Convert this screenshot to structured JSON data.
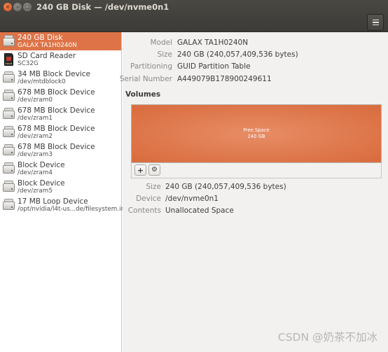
{
  "window": {
    "title": "240 GB Disk — /dev/nvme0n1",
    "close_glyph": "×",
    "minimize_glyph": "–",
    "maximize_glyph": "□",
    "menu_icon": "hamburger-menu-icon"
  },
  "sidebar": {
    "items": [
      {
        "name": "240 GB Disk",
        "sub": "GALAX TA1H0240N",
        "icon": "hard-disk-icon",
        "selected": true
      },
      {
        "name": "SD Card Reader",
        "sub": "SC32G",
        "icon": "sd-card-icon",
        "selected": false
      },
      {
        "name": "34 MB Block Device",
        "sub": "/dev/mtdblock0",
        "icon": "hard-disk-icon",
        "selected": false
      },
      {
        "name": "678 MB Block Device",
        "sub": "/dev/zram0",
        "icon": "hard-disk-icon",
        "selected": false
      },
      {
        "name": "678 MB Block Device",
        "sub": "/dev/zram1",
        "icon": "hard-disk-icon",
        "selected": false
      },
      {
        "name": "678 MB Block Device",
        "sub": "/dev/zram2",
        "icon": "hard-disk-icon",
        "selected": false
      },
      {
        "name": "678 MB Block Device",
        "sub": "/dev/zram3",
        "icon": "hard-disk-icon",
        "selected": false
      },
      {
        "name": "Block Device",
        "sub": "/dev/zram4",
        "icon": "hard-disk-icon",
        "selected": false
      },
      {
        "name": "Block Device",
        "sub": "/dev/zram5",
        "icon": "hard-disk-icon",
        "selected": false
      },
      {
        "name": "17 MB Loop Device",
        "sub": "/opt/nvidia/l4t-us...de/filesystem.img",
        "icon": "hard-disk-icon",
        "selected": false
      }
    ]
  },
  "disk_info": {
    "model_label": "Model",
    "model": "GALAX TA1H0240N",
    "size_label": "Size",
    "size": "240 GB (240,057,409,536 bytes)",
    "partitioning_label": "Partitioning",
    "partitioning": "GUID Partition Table",
    "serial_label": "Serial Number",
    "serial": "A449079B178900249611"
  },
  "volumes": {
    "heading": "Volumes",
    "block_name": "Free Space",
    "block_size": "240 GB",
    "add_glyph": "+",
    "settings_glyph": "⚙"
  },
  "volume_info": {
    "size_label": "Size",
    "size": "240 GB (240,057,409,536 bytes)",
    "device_label": "Device",
    "device": "/dev/nvme0n1",
    "contents_label": "Contents",
    "contents": "Unallocated Space"
  },
  "watermark": "CSDN @奶茶不加冰",
  "colors": {
    "accent": "#dd7346",
    "titlebar": "#3d3b37",
    "panel_bg": "#f2f1f0"
  }
}
